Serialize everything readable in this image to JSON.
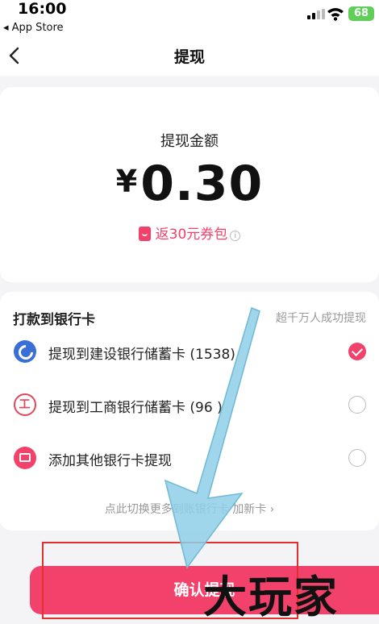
{
  "status_bar": {
    "time": "16:00",
    "back_app": "◂ App Store",
    "battery": "68"
  },
  "nav": {
    "title": "提现"
  },
  "amount": {
    "label": "提现金额",
    "currency": "¥",
    "value": "0.30",
    "coupon": "返30元券包"
  },
  "bank": {
    "header": "打款到银行卡",
    "hint": "超千万人成功提现",
    "options": [
      {
        "label": "提现到建设银行储蓄卡 (1538)",
        "icon": "ccb-bank-icon",
        "selected": true
      },
      {
        "label": "提现到工商银行储蓄卡 (96 )",
        "icon": "icbc-bank-icon",
        "selected": false
      },
      {
        "label": "添加其他银行卡提现",
        "icon": "add-card-icon",
        "selected": false
      }
    ],
    "more_link": "点此切换更多到账银行卡 加新卡 ›"
  },
  "confirm": {
    "label": "确认提现"
  },
  "watermark": "大玩家",
  "colors": {
    "accent": "#f2416a",
    "arrow": "#8ecfe8",
    "highlight_box": "#e23030"
  }
}
